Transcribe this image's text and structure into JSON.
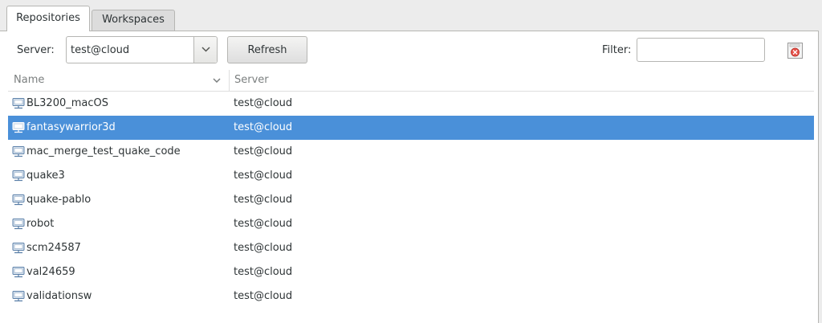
{
  "tabs": [
    {
      "label": "Repositories",
      "active": true
    },
    {
      "label": "Workspaces",
      "active": false
    }
  ],
  "toolbar": {
    "server_label": "Server:",
    "server_value": "test@cloud",
    "refresh_label": "Refresh",
    "filter_label": "Filter:",
    "filter_value": "",
    "filter_placeholder": ""
  },
  "table": {
    "columns": [
      "Name",
      "Server"
    ],
    "rows": [
      {
        "name": "BL3200_macOS",
        "server": "test@cloud",
        "selected": false
      },
      {
        "name": "fantasywarrior3d",
        "server": "test@cloud",
        "selected": true
      },
      {
        "name": "mac_merge_test_quake_code",
        "server": "test@cloud",
        "selected": false
      },
      {
        "name": "quake3",
        "server": "test@cloud",
        "selected": false
      },
      {
        "name": "quake-pablo",
        "server": "test@cloud",
        "selected": false
      },
      {
        "name": "robot",
        "server": "test@cloud",
        "selected": false
      },
      {
        "name": "scm24587",
        "server": "test@cloud",
        "selected": false
      },
      {
        "name": "val24659",
        "server": "test@cloud",
        "selected": false
      },
      {
        "name": "validationsw",
        "server": "test@cloud",
        "selected": false
      }
    ]
  },
  "icons": {
    "row_icon": "repository-icon",
    "sort": "chevron-down-icon",
    "combo": "chevron-down-icon",
    "clear": "clear-filter-icon"
  },
  "colors": {
    "selection": "#4a90d9",
    "icon_blue": "#5a7fa8"
  }
}
